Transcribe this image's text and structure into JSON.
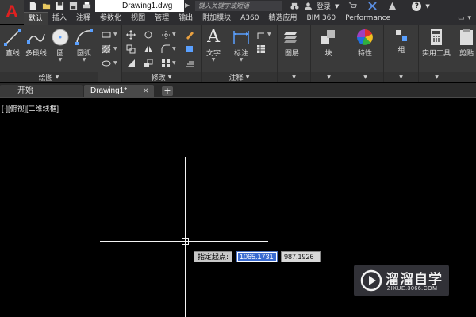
{
  "titlebar": {
    "app_logo": "A",
    "document_title": "Drawing1.dwg",
    "search_placeholder": "键入关键字或短语",
    "login_label": "登录",
    "help_label": "?"
  },
  "ribbon_tabs": [
    "默认",
    "插入",
    "注释",
    "参数化",
    "视图",
    "管理",
    "输出",
    "附加模块",
    "A360",
    "精选应用",
    "BIM 360",
    "Performance"
  ],
  "ribbon": {
    "draw_panel": {
      "title": "绘图",
      "tools": {
        "line": "直线",
        "polyline": "多段线",
        "circle": "圆",
        "arc": "圆弧"
      }
    },
    "modify_panel": {
      "title": "修改"
    },
    "annotation_panel": {
      "title": "注释",
      "tools": {
        "text": "文字",
        "dimension": "标注"
      }
    },
    "layers_label": "图层",
    "block_label": "块",
    "properties_label": "特性",
    "groups_label": "组",
    "utilities_label": "实用工具",
    "clipboard_label": "剪贴"
  },
  "file_tabs": {
    "start": "开始",
    "drawing": "Drawing1*",
    "close": "×",
    "add": "+"
  },
  "viewport": {
    "label": "[-][俯视][二维线框]"
  },
  "dynamic_input": {
    "prompt": "指定起点:",
    "x_value": "1065.1731",
    "y_value": "987.1926"
  },
  "watermark": {
    "title": "溜溜自学",
    "url": "ZIXUE.3066.COM"
  },
  "colors": {
    "accent_red": "#e02020",
    "selection_blue": "#3a6bd1",
    "ribbon_bg": "#3a3a3a"
  }
}
